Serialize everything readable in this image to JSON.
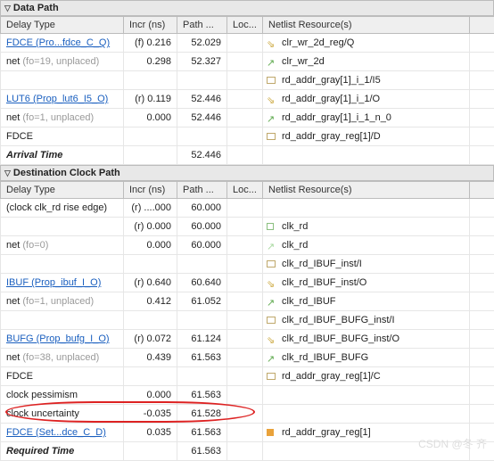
{
  "section1": {
    "title": "Data Path"
  },
  "section2": {
    "title": "Destination Clock Path"
  },
  "columns": {
    "delay": "Delay Type",
    "incr": "Incr (ns)",
    "path": "Path ...",
    "loc": "Loc...",
    "net": "Netlist Resource(s)"
  },
  "data_path_rows": [
    {
      "delay_link": "FDCE (Pro...fdce_C_Q)",
      "gray": "",
      "incr": "(f) 0.216",
      "path": "52.029",
      "icon": "arrow-yel",
      "net": "clr_wr_2d_reg/Q"
    },
    {
      "delay_text": "net",
      "gray": " (fo=19, unplaced)",
      "incr": "0.298",
      "path": "52.327",
      "icon": "arrow-gr",
      "net": "clr_wr_2d"
    },
    {
      "delay_text": "",
      "gray": "",
      "incr": "",
      "path": "",
      "icon": "cell",
      "net": "rd_addr_gray[1]_i_1/I5"
    },
    {
      "delay_link": "LUT6 (Prop_lut6_I5_O)",
      "gray": "",
      "incr": "(r) 0.119",
      "path": "52.446",
      "icon": "arrow-yel",
      "net": "rd_addr_gray[1]_i_1/O"
    },
    {
      "delay_text": "net",
      "gray": " (fo=1, unplaced)",
      "incr": "0.000",
      "path": "52.446",
      "icon": "arrow-gr",
      "net": "rd_addr_gray[1]_i_1_n_0"
    },
    {
      "delay_text": "FDCE",
      "gray": "",
      "incr": "",
      "path": "",
      "icon": "cell",
      "net": "rd_addr_gray_reg[1]/D"
    },
    {
      "delay_bi": "Arrival Time",
      "gray": "",
      "incr": "",
      "path": "52.446",
      "icon": "",
      "net": ""
    }
  ],
  "dest_rows": [
    {
      "delay_text": "(clock clk_rd rise edge)",
      "gray": "",
      "incr": "(r) ....000",
      "path": "60.000",
      "icon": "",
      "net": ""
    },
    {
      "delay_text": "",
      "gray": "",
      "incr": "(r) 0.000",
      "path": "60.000",
      "icon": "box",
      "net": "clk_rd"
    },
    {
      "delay_text": "net",
      "gray": " (fo=0)",
      "incr": "0.000",
      "path": "60.000",
      "icon": "arrow-ltgr",
      "net": "clk_rd"
    },
    {
      "delay_text": "",
      "gray": "",
      "incr": "",
      "path": "",
      "icon": "cell",
      "net": "clk_rd_IBUF_inst/I"
    },
    {
      "delay_link": "IBUF (Prop_ibuf_I_O)",
      "gray": "",
      "incr": "(r) 0.640",
      "path": "60.640",
      "icon": "arrow-yel",
      "net": "clk_rd_IBUF_inst/O"
    },
    {
      "delay_text": "net",
      "gray": " (fo=1, unplaced)",
      "incr": "0.412",
      "path": "61.052",
      "icon": "arrow-gr",
      "net": "clk_rd_IBUF"
    },
    {
      "delay_text": "",
      "gray": "",
      "incr": "",
      "path": "",
      "icon": "cell",
      "net": "clk_rd_IBUF_BUFG_inst/I"
    },
    {
      "delay_link": "BUFG (Prop_bufg_I_O)",
      "gray": "",
      "incr": "(r) 0.072",
      "path": "61.124",
      "icon": "arrow-yel",
      "net": "clk_rd_IBUF_BUFG_inst/O"
    },
    {
      "delay_text": "net",
      "gray": " (fo=38, unplaced)",
      "incr": "0.439",
      "path": "61.563",
      "icon": "arrow-gr",
      "net": "clk_rd_IBUF_BUFG"
    },
    {
      "delay_text": "FDCE",
      "gray": "",
      "incr": "",
      "path": "",
      "icon": "cell",
      "net": "rd_addr_gray_reg[1]/C"
    },
    {
      "delay_text": "clock pessimism",
      "gray": "",
      "incr": "0.000",
      "path": "61.563",
      "icon": "",
      "net": ""
    },
    {
      "delay_text": "clock uncertainty",
      "gray": "",
      "incr": "-0.035",
      "path": "61.528",
      "icon": "",
      "net": ""
    },
    {
      "delay_link": "FDCE (Set...dce_C_D)",
      "gray": "",
      "incr": "0.035",
      "path": "61.563",
      "icon": "box-filled",
      "net": "rd_addr_gray_reg[1]"
    },
    {
      "delay_bi": "Required Time",
      "gray": "",
      "incr": "",
      "path": "61.563",
      "icon": "",
      "net": ""
    }
  ],
  "watermark": "CSDN @冬 齐"
}
